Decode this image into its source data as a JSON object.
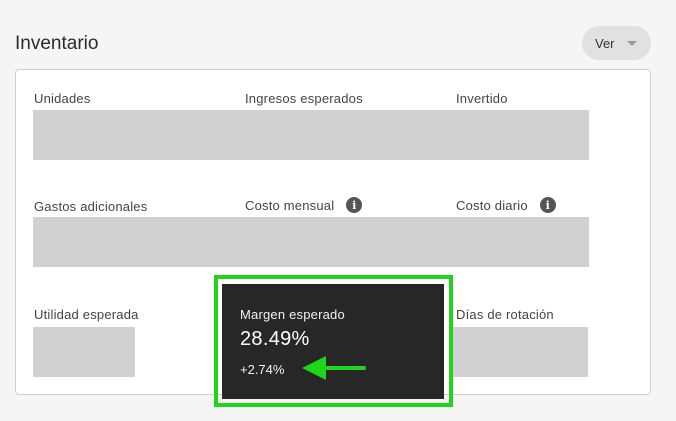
{
  "header": {
    "title": "Inventario",
    "view_button": "Ver"
  },
  "metrics": {
    "units": "Unidades",
    "expected_revenue": "Ingresos esperados",
    "invested": "Invertido",
    "additional_expenses": "Gastos adicionales",
    "monthly_cost": "Costo mensual",
    "daily_cost": "Costo diario",
    "expected_profit": "Utilidad esperada",
    "rotation_days": "Días de rotación"
  },
  "highlight_card": {
    "label": "Margen esperado",
    "value": "28.49%",
    "delta": "+2.74%"
  },
  "info_icon_glyph": "i",
  "colors": {
    "highlight_border": "#1ed617",
    "card_dark": "#272727",
    "placeholder": "#d1d1d1"
  }
}
